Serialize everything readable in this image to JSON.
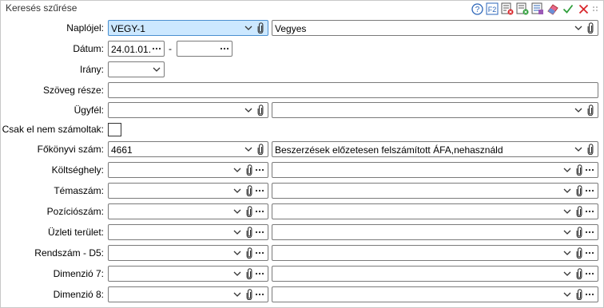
{
  "panel": {
    "title": "Keresés szűrése"
  },
  "toolbar": {
    "icons": [
      "help-icon",
      "f2-icon",
      "clear-filter-icon",
      "delete-filter-icon",
      "filter-settings-icon",
      "eraser-icon",
      "ok-check-icon",
      "cancel-x-icon"
    ],
    "colors": {
      "check": "#2e9e3a",
      "x": "#d9262b",
      "accent": "#2b65b8"
    }
  },
  "fields": {
    "naplojel": {
      "label": "Naplójel:",
      "code": "VEGY-1",
      "name": "Vegyes"
    },
    "datum": {
      "label": "Dátum:",
      "from": "24.01.01.",
      "to": "",
      "separator": "-"
    },
    "irany": {
      "label": "Irány:",
      "value": ""
    },
    "szoveg": {
      "label": "Szöveg része:",
      "value": ""
    },
    "ugyfel": {
      "label": "Ügyfél:",
      "code": "",
      "name": ""
    },
    "csak_el_nem": {
      "label": "Csak el nem számoltak:",
      "checked": false
    },
    "fokonyvi": {
      "label": "Főkönyvi szám:",
      "code": "4661",
      "name": "Beszerzések előzetesen felszámított ÁFA,nehasználd"
    },
    "koltseghely": {
      "label": "Költséghely:",
      "code": "",
      "name": ""
    },
    "temaszam": {
      "label": "Témaszám:",
      "code": "",
      "name": ""
    },
    "poziciosz": {
      "label": "Pozíciószám:",
      "code": "",
      "name": ""
    },
    "uzleti": {
      "label": "Üzleti terület:",
      "code": "",
      "name": ""
    },
    "rendszam": {
      "label": "Rendszám - D5:",
      "code": "",
      "name": ""
    },
    "dim7": {
      "label": "Dimenzió 7:",
      "code": "",
      "name": ""
    },
    "dim8": {
      "label": "Dimenzió 8:",
      "code": "",
      "name": ""
    }
  }
}
